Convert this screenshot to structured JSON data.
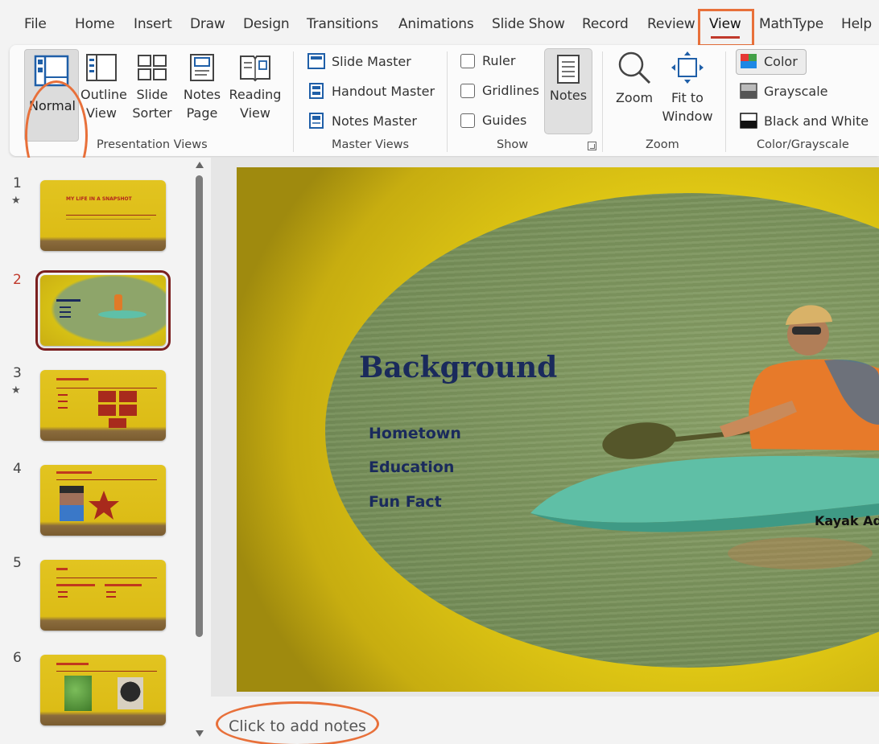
{
  "ribbon_tabs": [
    "File",
    "Home",
    "Insert",
    "Draw",
    "Design",
    "Transitions",
    "Animations",
    "Slide Show",
    "Record",
    "Review",
    "View",
    "MathType",
    "Help"
  ],
  "active_tab": "View",
  "ribbon": {
    "presentation_views": {
      "label": "Presentation Views",
      "normal": "Normal",
      "outline": [
        "Outline",
        "View"
      ],
      "slide_sorter": [
        "Slide",
        "Sorter"
      ],
      "notes_page": [
        "Notes",
        "Page"
      ],
      "reading_view": [
        "Reading",
        "View"
      ]
    },
    "master_views": {
      "label": "Master Views",
      "slide_master": "Slide Master",
      "handout_master": "Handout Master",
      "notes_master": "Notes Master"
    },
    "show": {
      "label": "Show",
      "ruler": "Ruler",
      "gridlines": "Gridlines",
      "guides": "Guides",
      "notes": "Notes"
    },
    "zoom": {
      "label": "Zoom",
      "zoom": "Zoom",
      "fit_to_window": [
        "Fit to",
        "Window"
      ]
    },
    "color_grayscale": {
      "label": "Color/Grayscale",
      "color": "Color",
      "grayscale": "Grayscale",
      "black_and_white": "Black and White"
    }
  },
  "thumbnails": [
    {
      "number": "1",
      "star": "★",
      "title": "MY LIFE IN A SNAPSHOT"
    },
    {
      "number": "2",
      "selected": true
    },
    {
      "number": "3",
      "star": "★"
    },
    {
      "number": "4"
    },
    {
      "number": "5"
    },
    {
      "number": "6"
    }
  ],
  "slide": {
    "title": "Background",
    "bullets": [
      "Hometown",
      "Education",
      "Fun Fact"
    ],
    "caption": "Kayak Ad"
  },
  "notes_placeholder": "Click to add notes",
  "colors": {
    "accent_orange": "#e8703a",
    "active_tab_underline": "#c0392b",
    "slide_yellow": "#e0c814",
    "title_navy": "#1a2a5c"
  }
}
